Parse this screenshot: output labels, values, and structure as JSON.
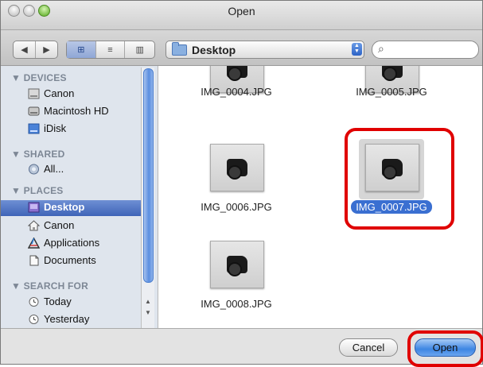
{
  "window": {
    "title": "Open"
  },
  "toolbar": {
    "nav_back": "◀",
    "nav_forward": "▶",
    "view_icon": "⊞",
    "view_list": "≡",
    "view_columns": "▥",
    "location": "Desktop",
    "search_icon": "⌕"
  },
  "sidebar": {
    "devices_header": "▼ DEVICES",
    "devices": [
      "Canon",
      "Macintosh HD",
      "iDisk"
    ],
    "shared_header": "▼ SHARED",
    "shared": [
      "All..."
    ],
    "places_header": "▼ PLACES",
    "places": [
      "Desktop",
      "Canon",
      "Applications",
      "Documents"
    ],
    "search_header": "▼ SEARCH FOR",
    "search": [
      "Today",
      "Yesterday"
    ]
  },
  "files": [
    "IMG_0004.JPG",
    "IMG_0005.JPG",
    "IMG_0006.JPG",
    "IMG_0007.JPG",
    "IMG_0008.JPG"
  ],
  "buttons": {
    "cancel": "Cancel",
    "open": "Open"
  },
  "colors": {
    "selection": "#3a6fd1",
    "highlight": "#e00000",
    "sidebar": "#dfe5ed"
  }
}
